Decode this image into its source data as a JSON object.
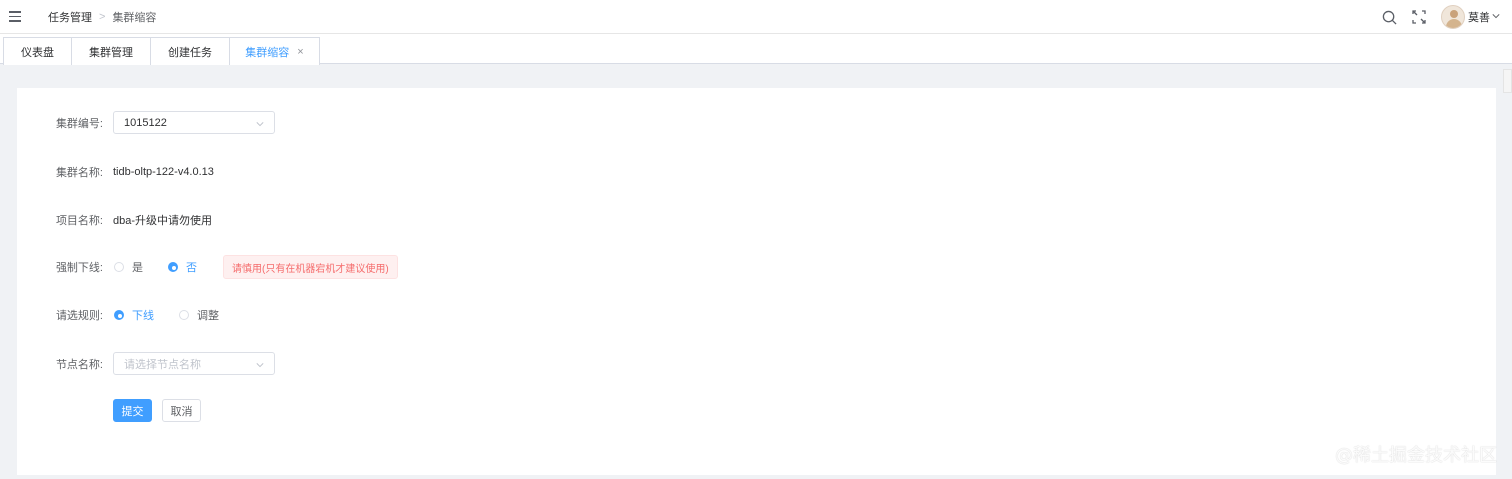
{
  "header": {
    "breadcrumb": [
      "任务管理",
      "集群缩容"
    ],
    "breadcrumb_separator": ">",
    "user_name": "莫善",
    "icons": [
      "hamburger-icon",
      "search-icon",
      "fullscreen-icon",
      "avatar",
      "chevron-down-icon"
    ]
  },
  "tags": [
    {
      "label": "仪表盘",
      "active": false
    },
    {
      "label": "集群管理",
      "active": false
    },
    {
      "label": "创建任务",
      "active": false
    },
    {
      "label": "集群缩容",
      "active": true,
      "close": "×"
    }
  ],
  "form": {
    "cluster_id": {
      "label": "集群编号:",
      "value": "1015122"
    },
    "cluster_name": {
      "label": "集群名称:",
      "value": "tidb-oltp-122-v4.0.13"
    },
    "project_name": {
      "label": "项目名称:",
      "value": "dba-升级中请勿使用"
    },
    "force_offline": {
      "label": "强制下线:",
      "options": [
        {
          "label": "是",
          "checked": false
        },
        {
          "label": "否",
          "checked": true
        }
      ],
      "warning": "请慎用(只有在机器宕机才建议使用)"
    },
    "rule": {
      "label": "请选规则:",
      "options": [
        {
          "label": "下线",
          "checked": true
        },
        {
          "label": "调整",
          "checked": false
        }
      ]
    },
    "node_name": {
      "label": "节点名称:",
      "placeholder": "请选择节点名称"
    },
    "submit_label": "提交",
    "cancel_label": "取消"
  },
  "watermark": "@稀土掘金技术社区",
  "colors": {
    "accent": "#409eff",
    "danger": "#f56c6c",
    "danger_bg": "#fef0f0"
  }
}
